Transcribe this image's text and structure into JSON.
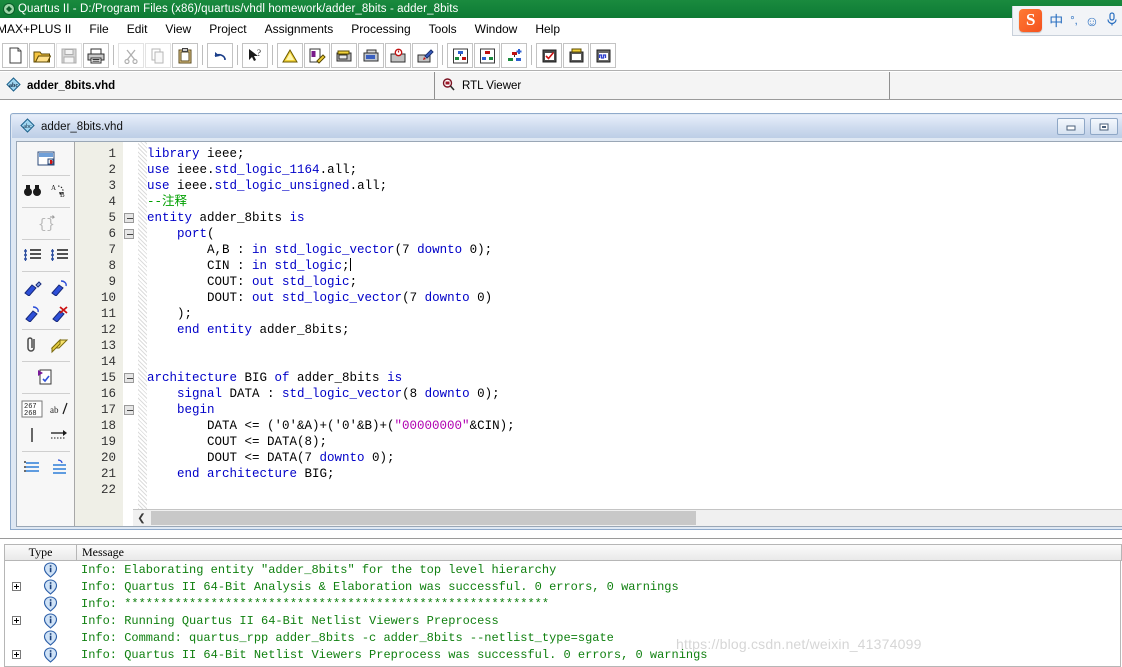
{
  "window": {
    "title": "Quartus II - D:/Program Files (x86)/quartus/vhdl homework/adder_8bits - adder_8bits",
    "app_icon": "quartus-icon",
    "minimize_label": "–",
    "restore_label": "□"
  },
  "ime": {
    "logo": "S",
    "mode": "中",
    "punct": "°,",
    "smiley": "☺",
    "mic": "ᵓ"
  },
  "menubar": {
    "items": [
      {
        "label": "MAX+PLUS II"
      },
      {
        "label": "File"
      },
      {
        "label": "Edit"
      },
      {
        "label": "View"
      },
      {
        "label": "Project"
      },
      {
        "label": "Assignments"
      },
      {
        "label": "Processing"
      },
      {
        "label": "Tools"
      },
      {
        "label": "Window"
      },
      {
        "label": "Help"
      }
    ]
  },
  "toolbar": {
    "buttons": [
      {
        "name": "new-file-button",
        "icon": "new-document-icon",
        "disabled": false
      },
      {
        "name": "open-file-button",
        "icon": "open-folder-icon",
        "disabled": false
      },
      {
        "name": "save-file-button",
        "icon": "save-disk-icon",
        "disabled": true
      },
      {
        "name": "print-button",
        "icon": "printer-icon",
        "disabled": false
      },
      {
        "name": "cut-button",
        "icon": "scissors-icon",
        "disabled": true
      },
      {
        "name": "copy-button",
        "icon": "copy-pages-icon",
        "disabled": true
      },
      {
        "name": "paste-button",
        "icon": "clipboard-icon",
        "disabled": false
      },
      {
        "name": "undo-button",
        "icon": "undo-arrow-icon",
        "disabled": false
      },
      {
        "name": "context-help-button",
        "icon": "arrow-question-icon",
        "disabled": false
      },
      {
        "name": "analysis-button",
        "icon": "yellow-triangle-icon",
        "disabled": false
      },
      {
        "name": "analysis-synthesis-button",
        "icon": "page-pencil-icon",
        "disabled": false
      },
      {
        "name": "fitter-button",
        "icon": "chip-fit-icon",
        "disabled": false
      },
      {
        "name": "assembler-button",
        "icon": "chip-assemble-icon",
        "disabled": false
      },
      {
        "name": "timing-analyzer-button",
        "icon": "chip-clock-icon",
        "disabled": false
      },
      {
        "name": "programmer-button",
        "icon": "chip-brush-icon",
        "disabled": false
      },
      {
        "name": "rtl-viewer-button",
        "icon": "rtl-netlist-icon",
        "disabled": false
      },
      {
        "name": "technology-map-button",
        "icon": "tech-map-icon",
        "disabled": false
      },
      {
        "name": "state-machine-button",
        "icon": "hierarchy-plus-icon",
        "disabled": false
      },
      {
        "name": "compile-check-button",
        "icon": "disk-check-icon",
        "disabled": false
      },
      {
        "name": "start-compilation-button",
        "icon": "disk-run-icon",
        "disabled": false
      },
      {
        "name": "start-simulation-button",
        "icon": "disk-wave-icon",
        "disabled": false
      }
    ]
  },
  "tabstrip": {
    "tabs": [
      {
        "label": "adder_8bits.vhd",
        "icon": "vhdl-abc-icon",
        "active": true
      },
      {
        "label": "RTL Viewer",
        "icon": "rtl-magnifier-icon",
        "active": false
      }
    ]
  },
  "editor_window": {
    "title": "adder_8bits.vhd",
    "icon": "vhdl-abc-icon"
  },
  "vertical_toolbar": {
    "buttons": [
      {
        "name": "insert-template-button",
        "icon": "insert-template-icon"
      },
      {
        "name": "find-button",
        "icon": "binoculars-find-icon"
      },
      {
        "name": "replace-button",
        "icon": "find-replace-ab-icon"
      },
      {
        "name": "match-brace-button",
        "icon": "curly-brace-icon"
      },
      {
        "name": "increase-indent-button",
        "icon": "indent-increase-icon"
      },
      {
        "name": "decrease-indent-button",
        "icon": "indent-decrease-icon"
      },
      {
        "name": "comment-selection-button",
        "icon": "comment-pen-blue-icon"
      },
      {
        "name": "uncomment-selection-button",
        "icon": "uncomment-pen-icon"
      },
      {
        "name": "insert-comment-button",
        "icon": "pen-arrow-icon"
      },
      {
        "name": "delete-comment-button",
        "icon": "pen-delete-red-icon"
      },
      {
        "name": "bookmark-button",
        "icon": "paperclip-icon"
      },
      {
        "name": "notes-button",
        "icon": "yellow-note-icon"
      },
      {
        "name": "check-syntax-button",
        "icon": "page-check-play-icon"
      },
      {
        "name": "line-numbers-button",
        "icon": "line-number-267-268-icon"
      },
      {
        "name": "word-wrap-button",
        "icon": "ab-slash-icon"
      },
      {
        "name": "show-margin-button",
        "icon": "vertical-bar-icon"
      },
      {
        "name": "show-whitespace-button",
        "icon": "dotted-arrow-icon"
      },
      {
        "name": "collapse-all-button",
        "icon": "collapse-lines-icon"
      },
      {
        "name": "expand-all-button",
        "icon": "expand-lines-icon"
      }
    ]
  },
  "code": {
    "lines": [
      {
        "n": "1",
        "fold": false,
        "tokens": [
          {
            "t": "library",
            "c": "k"
          },
          {
            "t": " ieee;",
            "c": ""
          }
        ],
        "indent": 0
      },
      {
        "n": "2",
        "fold": false,
        "tokens": [
          {
            "t": "use",
            "c": "k"
          },
          {
            "t": " ieee.",
            "c": ""
          },
          {
            "t": "std_logic_1164",
            "c": "k"
          },
          {
            "t": ".all;",
            "c": ""
          }
        ],
        "indent": 0
      },
      {
        "n": "3",
        "fold": false,
        "tokens": [
          {
            "t": "use",
            "c": "k"
          },
          {
            "t": " ieee.",
            "c": ""
          },
          {
            "t": "std_logic_unsigned",
            "c": "k"
          },
          {
            "t": ".all;",
            "c": ""
          }
        ],
        "indent": 0
      },
      {
        "n": "4",
        "fold": false,
        "tokens": [
          {
            "t": "--注释",
            "c": "cm"
          }
        ],
        "indent": 0
      },
      {
        "n": "5",
        "fold": true,
        "tokens": [
          {
            "t": "entity",
            "c": "k"
          },
          {
            "t": " adder_8bits ",
            "c": ""
          },
          {
            "t": "is",
            "c": "k"
          }
        ],
        "indent": 0
      },
      {
        "n": "6",
        "fold": true,
        "tokens": [
          {
            "t": "    ",
            "c": ""
          },
          {
            "t": "port",
            "c": "k"
          },
          {
            "t": "(",
            "c": ""
          }
        ],
        "indent": 0
      },
      {
        "n": "7",
        "fold": false,
        "tokens": [
          {
            "t": "        A,B : ",
            "c": ""
          },
          {
            "t": "in std_logic_vector",
            "c": "k"
          },
          {
            "t": "(7 ",
            "c": ""
          },
          {
            "t": "downto",
            "c": "k"
          },
          {
            "t": " 0);",
            "c": ""
          }
        ],
        "indent": 0
      },
      {
        "n": "8",
        "fold": false,
        "tokens": [
          {
            "t": "        CIN : ",
            "c": ""
          },
          {
            "t": "in std_logic",
            "c": "k"
          },
          {
            "t": ";",
            "c": ""
          },
          {
            "t": "|caret|",
            "c": "caret"
          }
        ],
        "indent": 0
      },
      {
        "n": "9",
        "fold": false,
        "tokens": [
          {
            "t": "        COUT: ",
            "c": ""
          },
          {
            "t": "out std_logic",
            "c": "k"
          },
          {
            "t": ";",
            "c": ""
          }
        ],
        "indent": 0
      },
      {
        "n": "10",
        "fold": false,
        "tokens": [
          {
            "t": "        DOUT: ",
            "c": ""
          },
          {
            "t": "out std_logic_vector",
            "c": "k"
          },
          {
            "t": "(7 ",
            "c": ""
          },
          {
            "t": "downto",
            "c": "k"
          },
          {
            "t": " 0)",
            "c": ""
          }
        ],
        "indent": 0
      },
      {
        "n": "11",
        "fold": false,
        "tokens": [
          {
            "t": "    );",
            "c": ""
          }
        ],
        "indent": 0
      },
      {
        "n": "12",
        "fold": false,
        "tokens": [
          {
            "t": "    ",
            "c": ""
          },
          {
            "t": "end entity",
            "c": "k"
          },
          {
            "t": " adder_8bits;",
            "c": ""
          }
        ],
        "indent": 0
      },
      {
        "n": "13",
        "fold": false,
        "tokens": [
          {
            "t": "",
            "c": ""
          }
        ],
        "indent": 0
      },
      {
        "n": "14",
        "fold": false,
        "tokens": [
          {
            "t": "",
            "c": ""
          }
        ],
        "indent": 0
      },
      {
        "n": "15",
        "fold": true,
        "tokens": [
          {
            "t": "architecture",
            "c": "k"
          },
          {
            "t": " BIG ",
            "c": ""
          },
          {
            "t": "of",
            "c": "k"
          },
          {
            "t": " adder_8bits ",
            "c": ""
          },
          {
            "t": "is",
            "c": "k"
          }
        ],
        "indent": 0
      },
      {
        "n": "16",
        "fold": false,
        "tokens": [
          {
            "t": "    ",
            "c": ""
          },
          {
            "t": "signal",
            "c": "k"
          },
          {
            "t": " DATA : ",
            "c": ""
          },
          {
            "t": "std_logic_vector",
            "c": "k"
          },
          {
            "t": "(8 ",
            "c": ""
          },
          {
            "t": "downto",
            "c": "k"
          },
          {
            "t": " 0);",
            "c": ""
          }
        ],
        "indent": 0
      },
      {
        "n": "17",
        "fold": true,
        "tokens": [
          {
            "t": "    ",
            "c": ""
          },
          {
            "t": "begin",
            "c": "k"
          }
        ],
        "indent": 0
      },
      {
        "n": "18",
        "fold": false,
        "tokens": [
          {
            "t": "        DATA <= ('0'&A)+('0'&B)+(",
            "c": ""
          },
          {
            "t": "\"00000000\"",
            "c": "st"
          },
          {
            "t": "&CIN);",
            "c": ""
          }
        ],
        "indent": 0
      },
      {
        "n": "19",
        "fold": false,
        "tokens": [
          {
            "t": "        COUT <= DATA(8);",
            "c": ""
          }
        ],
        "indent": 0
      },
      {
        "n": "20",
        "fold": false,
        "tokens": [
          {
            "t": "        DOUT <= DATA(7 ",
            "c": ""
          },
          {
            "t": "downto",
            "c": "k"
          },
          {
            "t": " 0);",
            "c": ""
          }
        ],
        "indent": 0
      },
      {
        "n": "21",
        "fold": false,
        "tokens": [
          {
            "t": "    ",
            "c": ""
          },
          {
            "t": "end architecture",
            "c": "k"
          },
          {
            "t": " BIG;",
            "c": ""
          }
        ],
        "indent": 0
      },
      {
        "n": "22",
        "fold": false,
        "tokens": [
          {
            "t": "",
            "c": ""
          }
        ],
        "indent": 0
      }
    ]
  },
  "messages": {
    "columns": {
      "type": "Type",
      "message": "Message"
    },
    "rows": [
      {
        "expandable": false,
        "icon": "info-icon",
        "text": "Info: Elaborating entity \"adder_8bits\" for the top level hierarchy"
      },
      {
        "expandable": true,
        "icon": "info-icon",
        "text": "Info: Quartus II 64-Bit Analysis & Elaboration was successful. 0 errors, 0 warnings"
      },
      {
        "expandable": false,
        "icon": "info-icon",
        "text": "Info: ***********************************************************"
      },
      {
        "expandable": true,
        "icon": "info-icon",
        "text": "Info: Running Quartus II 64-Bit Netlist Viewers Preprocess"
      },
      {
        "expandable": false,
        "icon": "info-icon",
        "text": "Info: Command: quartus_rpp adder_8bits -c adder_8bits --netlist_type=sgate"
      },
      {
        "expandable": true,
        "icon": "info-icon",
        "text": "Info: Quartus II 64-Bit Netlist Viewers Preprocess was successful. 0 errors, 0 warnings"
      }
    ]
  },
  "watermark": {
    "text": "https://blog.csdn.net/weixin_41374099"
  },
  "colors": {
    "titlebar": "#12803a",
    "keyword": "#0000c8",
    "comment": "#00a000",
    "string": "#b000b0",
    "message_text": "#108010",
    "mdi_title": "#cfdcef"
  }
}
